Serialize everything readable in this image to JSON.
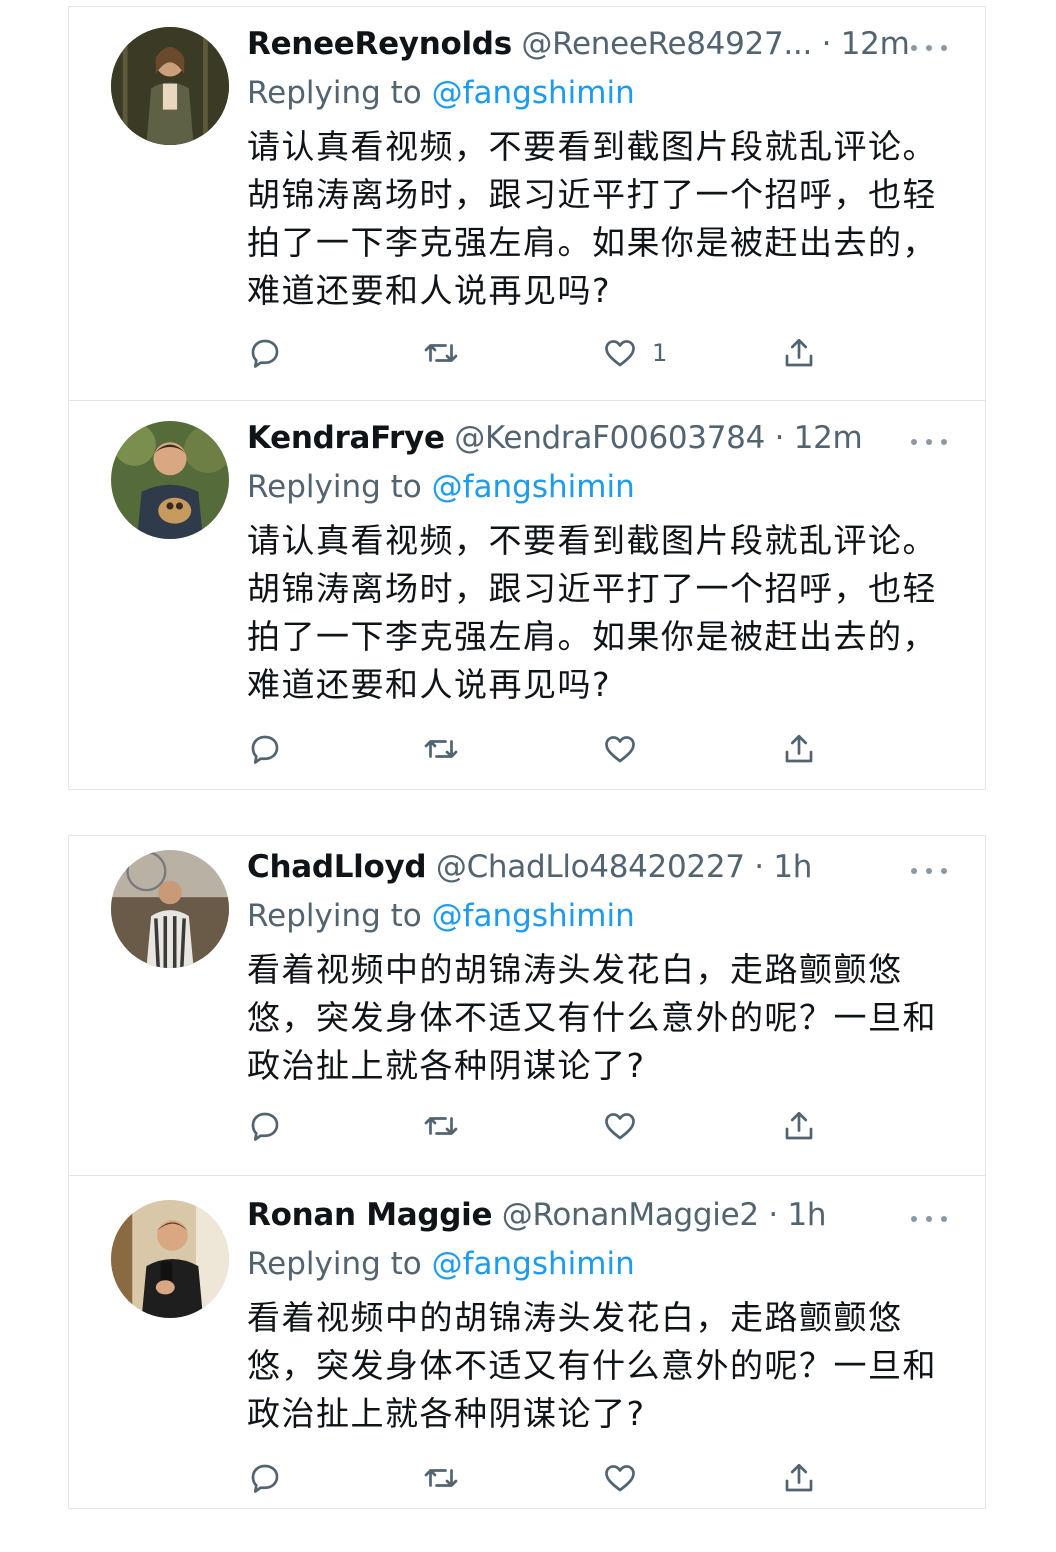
{
  "theme": {
    "accent": "#1d9bf0",
    "text": "#0f1419",
    "muted": "#536471",
    "border": "#e3e6e8"
  },
  "replies": [
    {
      "name": "ReneeReynolds",
      "handle": "@ReneeRe84927...",
      "separator": "·",
      "time": "12m",
      "replying_prefix": "Replying to ",
      "replying_to": "@fangshimin",
      "lines": [
        "请认真看视频，不要看到截图片段就乱评论。",
        "胡锦涛离场时，跟习近平打了一个招呼，也轻",
        "拍了一下李克强左肩。如果你是被赶出去的，",
        "难道还要和人说再见吗?"
      ],
      "like_count": "1",
      "avatar_icon": "profile-photo"
    },
    {
      "name": "KendraFrye",
      "handle": "@KendraF00603784",
      "separator": "·",
      "time": "12m",
      "replying_prefix": "Replying to ",
      "replying_to": "@fangshimin",
      "lines": [
        "请认真看视频，不要看到截图片段就乱评论。",
        "胡锦涛离场时，跟习近平打了一个招呼，也轻",
        "拍了一下李克强左肩。如果你是被赶出去的，",
        "难道还要和人说再见吗?"
      ],
      "like_count": "",
      "avatar_icon": "profile-photo"
    },
    {
      "name": "ChadLloyd",
      "handle": "@ChadLlo48420227",
      "separator": "·",
      "time": "1h",
      "replying_prefix": "Replying to ",
      "replying_to": "@fangshimin",
      "lines": [
        "看着视频中的胡锦涛头发花白，走路颤颤悠",
        "悠，突发身体不适又有什么意外的呢？一旦和",
        "政治扯上就各种阴谋论了?"
      ],
      "like_count": "",
      "avatar_icon": "profile-photo"
    },
    {
      "name": "Ronan Maggie",
      "handle": "@RonanMaggie2",
      "separator": "·",
      "time": "1h",
      "replying_prefix": "Replying to ",
      "replying_to": "@fangshimin",
      "lines": [
        "看着视频中的胡锦涛头发花白，走路颤颤悠",
        "悠，突发身体不适又有什么意外的呢？一旦和",
        "政治扯上就各种阴谋论了?"
      ],
      "like_count": "",
      "avatar_icon": "profile-photo"
    }
  ],
  "icons": {
    "reply": "reply-bubble-icon",
    "retweet": "retweet-icon",
    "like": "heart-icon",
    "share": "share-upload-icon",
    "more": "more-dots-icon"
  }
}
